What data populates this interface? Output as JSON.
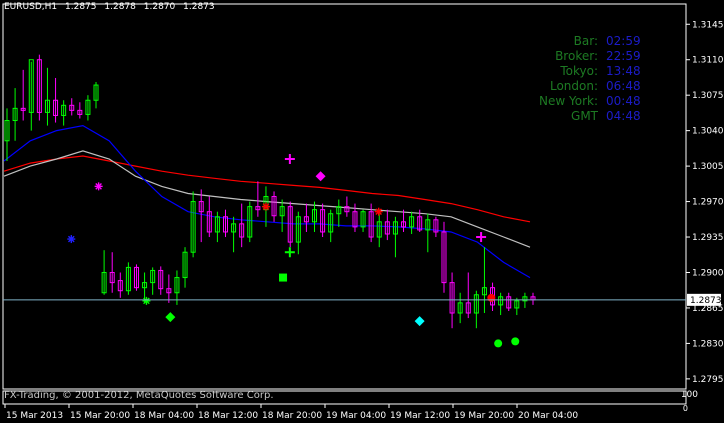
{
  "window": {
    "symbol_label": "EURUSD,H1",
    "ohlc": [
      "1.2875",
      "1.2878",
      "1.2870",
      "1.2873"
    ]
  },
  "clock": [
    {
      "label": "Bar:",
      "value": "02:59"
    },
    {
      "label": "Broker:",
      "value": "22:59"
    },
    {
      "label": "Tokyo:",
      "value": "13:48"
    },
    {
      "label": "London:",
      "value": "06:48"
    },
    {
      "label": "New York:",
      "value": "00:48"
    },
    {
      "label": "GMT",
      "value": "04:48"
    }
  ],
  "status_bar": {
    "copyright": "FX-Trading, © 2001-2012, MetaQuotes Software Corp.",
    "subwindow_max": "100",
    "subwindow_label": "0"
  },
  "colors": {
    "background": "#000000",
    "grid": "#ffffff",
    "bull_candle": "#00ff00",
    "bear_candle": "#ff00ff",
    "ma_fast": "#0000ff",
    "ma_mid": "#c0c0c0",
    "ma_slow": "#ff0000",
    "price_line": "#7fb2c8"
  },
  "chart_data": {
    "type": "candlestick",
    "y_ticks": [
      "1.3145",
      "1.3110",
      "1.3075",
      "1.3040",
      "1.3005",
      "1.2970",
      "1.2935",
      "1.2900",
      "1.2865",
      "1.2830",
      "1.2795"
    ],
    "current_price": "1.2873",
    "x_ticks": [
      "15 Mar 2013",
      "15 Mar 20:00",
      "18 Mar 04:00",
      "18 Mar 12:00",
      "18 Mar 20:00",
      "19 Mar 04:00",
      "19 Mar 12:00",
      "19 Mar 20:00",
      "20 Mar 04:00"
    ],
    "ylim": [
      1.2785,
      1.3165
    ],
    "candles": [
      [
        1.303,
        1.3062,
        1.301,
        1.305
      ],
      [
        1.305,
        1.3082,
        1.303,
        1.3062
      ],
      [
        1.3062,
        1.31,
        1.305,
        1.306
      ],
      [
        1.3058,
        1.3108,
        1.304,
        1.311
      ],
      [
        1.311,
        1.3115,
        1.305,
        1.3058
      ],
      [
        1.3058,
        1.3102,
        1.3045,
        1.307
      ],
      [
        1.307,
        1.3092,
        1.3048,
        1.3055
      ],
      [
        1.3055,
        1.307,
        1.3045,
        1.3065
      ],
      [
        1.3065,
        1.3072,
        1.3055,
        1.306
      ],
      [
        1.306,
        1.3068,
        1.3052,
        1.3056
      ],
      [
        1.3056,
        1.3075,
        1.305,
        1.307
      ],
      [
        1.307,
        1.3088,
        1.3062,
        1.3085
      ],
      [
        1.288,
        1.2922,
        1.2878,
        1.29
      ],
      [
        1.29,
        1.292,
        1.288,
        1.289
      ],
      [
        1.2892,
        1.29,
        1.2875,
        1.2882
      ],
      [
        1.2882,
        1.291,
        1.2878,
        1.2905
      ],
      [
        1.2905,
        1.2908,
        1.2882,
        1.2885
      ],
      [
        1.2885,
        1.29,
        1.287,
        1.289
      ],
      [
        1.289,
        1.2905,
        1.2878,
        1.2902
      ],
      [
        1.2902,
        1.2906,
        1.2878,
        1.2884
      ],
      [
        1.2884,
        1.2898,
        1.287,
        1.288
      ],
      [
        1.288,
        1.2902,
        1.2868,
        1.2895
      ],
      [
        1.2895,
        1.2925,
        1.2885,
        1.292
      ],
      [
        1.292,
        1.298,
        1.2915,
        1.297
      ],
      [
        1.297,
        1.2982,
        1.293,
        1.296
      ],
      [
        1.296,
        1.2975,
        1.2935,
        1.294
      ],
      [
        1.294,
        1.296,
        1.293,
        1.2955
      ],
      [
        1.2955,
        1.2962,
        1.2935,
        1.294
      ],
      [
        1.294,
        1.2955,
        1.292,
        1.2948
      ],
      [
        1.2948,
        1.2968,
        1.2925,
        1.2935
      ],
      [
        1.2935,
        1.297,
        1.293,
        1.2965
      ],
      [
        1.2965,
        1.299,
        1.2955,
        1.2962
      ],
      [
        1.2962,
        1.2985,
        1.2945,
        1.2975
      ],
      [
        1.2975,
        1.298,
        1.295,
        1.2956
      ],
      [
        1.2956,
        1.2972,
        1.294,
        1.2965
      ],
      [
        1.2965,
        1.297,
        1.2925,
        1.293
      ],
      [
        1.293,
        1.296,
        1.2918,
        1.2955
      ],
      [
        1.2955,
        1.2968,
        1.294,
        1.295
      ],
      [
        1.295,
        1.297,
        1.294,
        1.2962
      ],
      [
        1.2962,
        1.2968,
        1.2935,
        1.294
      ],
      [
        1.294,
        1.2962,
        1.293,
        1.2958
      ],
      [
        1.2958,
        1.2972,
        1.2945,
        1.2965
      ],
      [
        1.2965,
        1.2975,
        1.2955,
        1.296
      ],
      [
        1.296,
        1.2968,
        1.294,
        1.2945
      ],
      [
        1.2945,
        1.2962,
        1.294,
        1.296
      ],
      [
        1.296,
        1.2968,
        1.293,
        1.2935
      ],
      [
        1.2935,
        1.2958,
        1.2925,
        1.295
      ],
      [
        1.295,
        1.2962,
        1.2932,
        1.2938
      ],
      [
        1.2938,
        1.2955,
        1.2915,
        1.295
      ],
      [
        1.295,
        1.2962,
        1.294,
        1.2945
      ],
      [
        1.2945,
        1.296,
        1.2938,
        1.2955
      ],
      [
        1.2955,
        1.2962,
        1.294,
        1.2942
      ],
      [
        1.2942,
        1.2958,
        1.292,
        1.2952
      ],
      [
        1.2952,
        1.2955,
        1.2935,
        1.294
      ],
      [
        1.294,
        1.295,
        1.288,
        1.289
      ],
      [
        1.289,
        1.29,
        1.2845,
        1.286
      ],
      [
        1.286,
        1.288,
        1.285,
        1.287
      ],
      [
        1.287,
        1.29,
        1.2855,
        1.286
      ],
      [
        1.286,
        1.2882,
        1.2845,
        1.2878
      ],
      [
        1.2878,
        1.2925,
        1.286,
        1.2885
      ],
      [
        1.2885,
        1.289,
        1.2862,
        1.2868
      ],
      [
        1.2868,
        1.288,
        1.2858,
        1.2876
      ],
      [
        1.2876,
        1.288,
        1.2862,
        1.2865
      ],
      [
        1.2865,
        1.2875,
        1.2858,
        1.2872
      ],
      [
        1.2872,
        1.288,
        1.2865,
        1.2876
      ],
      [
        1.2876,
        1.288,
        1.2868,
        1.2873
      ]
    ],
    "candles_x_spacing_note": "",
    "ma_fast": [
      1.301,
      1.303,
      1.304,
      1.3045,
      1.303,
      1.3,
      1.2975,
      1.296,
      1.2955,
      1.2952,
      1.295,
      1.2948,
      1.2948,
      1.2946,
      1.2946,
      1.2945,
      1.2943,
      1.294,
      1.293,
      1.291,
      1.2895
    ],
    "ma_mid": [
      1.2995,
      1.3005,
      1.3012,
      1.302,
      1.3012,
      1.2995,
      1.2985,
      1.2978,
      1.2975,
      1.2972,
      1.297,
      1.2968,
      1.2966,
      1.2964,
      1.2962,
      1.296,
      1.2958,
      1.2955,
      1.2945,
      1.2935,
      1.2925
    ],
    "ma_slow": [
      1.3,
      1.3008,
      1.3012,
      1.3015,
      1.301,
      1.3005,
      1.3,
      1.2996,
      1.2993,
      1.299,
      1.2988,
      1.2986,
      1.2984,
      1.2981,
      1.2978,
      1.2976,
      1.2972,
      1.2968,
      1.2962,
      1.2955,
      1.295
    ],
    "markers": [
      {
        "shape": "star",
        "color": "#ff00ff",
        "price": 1.2985,
        "x_frac": 0.14
      },
      {
        "shape": "star",
        "color": "#2020ff",
        "price": 1.2933,
        "x_frac": 0.1
      },
      {
        "shape": "star",
        "color": "#00ff00",
        "price": 1.2872,
        "x_frac": 0.21
      },
      {
        "shape": "diamond",
        "color": "#00ff00",
        "price": 1.2856,
        "x_frac": 0.245
      },
      {
        "shape": "cross",
        "color": "#ff00ff",
        "price": 1.3012,
        "x_frac": 0.42
      },
      {
        "shape": "diamond",
        "color": "#ff00ff",
        "price": 1.2995,
        "x_frac": 0.465
      },
      {
        "shape": "square",
        "color": "#00ff00",
        "price": 1.2895,
        "x_frac": 0.41
      },
      {
        "shape": "cross",
        "color": "#00ff00",
        "price": 1.292,
        "x_frac": 0.42
      },
      {
        "shape": "star",
        "color": "#ff0000",
        "price": 1.2965,
        "x_frac": 0.385
      },
      {
        "shape": "star",
        "color": "#ff0000",
        "price": 1.296,
        "x_frac": 0.55
      },
      {
        "shape": "cross",
        "color": "#ff00ff",
        "price": 1.2935,
        "x_frac": 0.7
      },
      {
        "shape": "diamond",
        "color": "#00ffff",
        "price": 1.2852,
        "x_frac": 0.61
      },
      {
        "shape": "circle",
        "color": "#ff0000",
        "price": 1.2875,
        "x_frac": 0.715
      },
      {
        "shape": "circle",
        "color": "#00ff00",
        "price": 1.2832,
        "x_frac": 0.75
      },
      {
        "shape": "circle",
        "color": "#00ff00",
        "price": 1.283,
        "x_frac": 0.725
      }
    ]
  }
}
